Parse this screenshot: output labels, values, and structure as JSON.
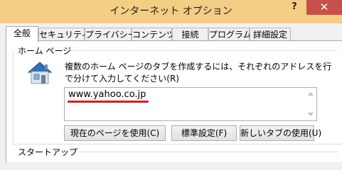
{
  "window": {
    "title": "インターネット オプション",
    "help_label": "?",
    "close_label": "✕",
    "titlebar_color": "#f5ce85",
    "close_color": "#c7504a"
  },
  "tabs": [
    {
      "label": "全般",
      "active": true
    },
    {
      "label": "セキュリティ",
      "active": false
    },
    {
      "label": "プライバシー",
      "active": false
    },
    {
      "label": "コンテンツ",
      "active": false
    },
    {
      "label": "接続",
      "active": false
    },
    {
      "label": "プログラム",
      "active": false
    },
    {
      "label": "詳細設定",
      "active": false
    }
  ],
  "home_page": {
    "group_title": "ホーム ページ",
    "icon": "house-icon",
    "description": "複数のホーム ページのタブを作成するには、それぞれのアドレスを行で分けて入力してください(R)",
    "url_value": "www.yahoo.co.jp",
    "underline_color": "#d11c25",
    "buttons": {
      "current": "現在のページを使用(C)",
      "default": "標準設定(F)",
      "new_tab": "新しいタブの使用(U)"
    }
  },
  "startup": {
    "group_title": "スタートアップ"
  }
}
